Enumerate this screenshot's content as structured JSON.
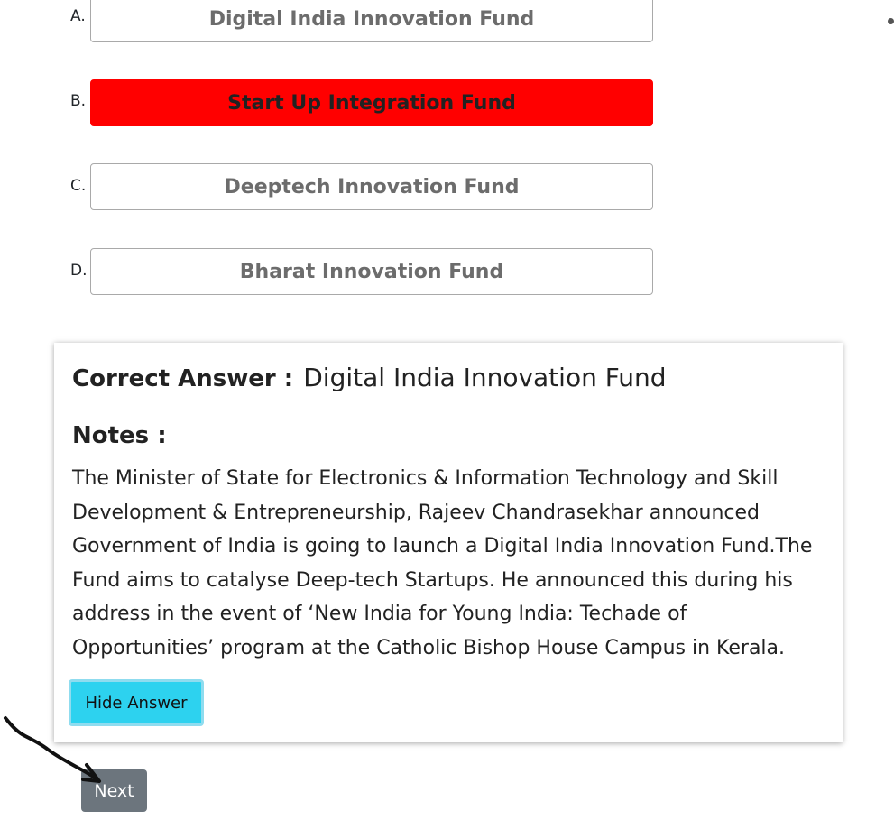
{
  "options": [
    {
      "letter": "A.",
      "text": "Digital India Innovation Fund",
      "state": "normal"
    },
    {
      "letter": "B.",
      "text": "Start Up Integration Fund",
      "state": "selected-wrong"
    },
    {
      "letter": "C.",
      "text": "Deeptech Innovation Fund",
      "state": "normal"
    },
    {
      "letter": "D.",
      "text": "Bharat Innovation Fund",
      "state": "normal"
    }
  ],
  "answer": {
    "label": "Correct Answer :",
    "value": "Digital India Innovation Fund",
    "notes_label": "Notes :",
    "notes": "The Minister of State for Electronics & Information Technology and Skill Development & Entrepreneurship, Rajeev Chandrasekhar announced Government of India is going to launch a Digital India Innovation Fund.The Fund aims to catalyse Deep-tech Startups. He announced this during his address in the event of ‘New India for Young India: Techade of Opportunities’ program at the Catholic Bishop House Campus in Kerala.",
    "hide_button": "Hide Answer"
  },
  "navigation": {
    "next_button": "Next"
  },
  "colors": {
    "wrong_selection": "#ff0000",
    "hide_button": "#2dd2ef",
    "next_button": "#6c757d"
  }
}
